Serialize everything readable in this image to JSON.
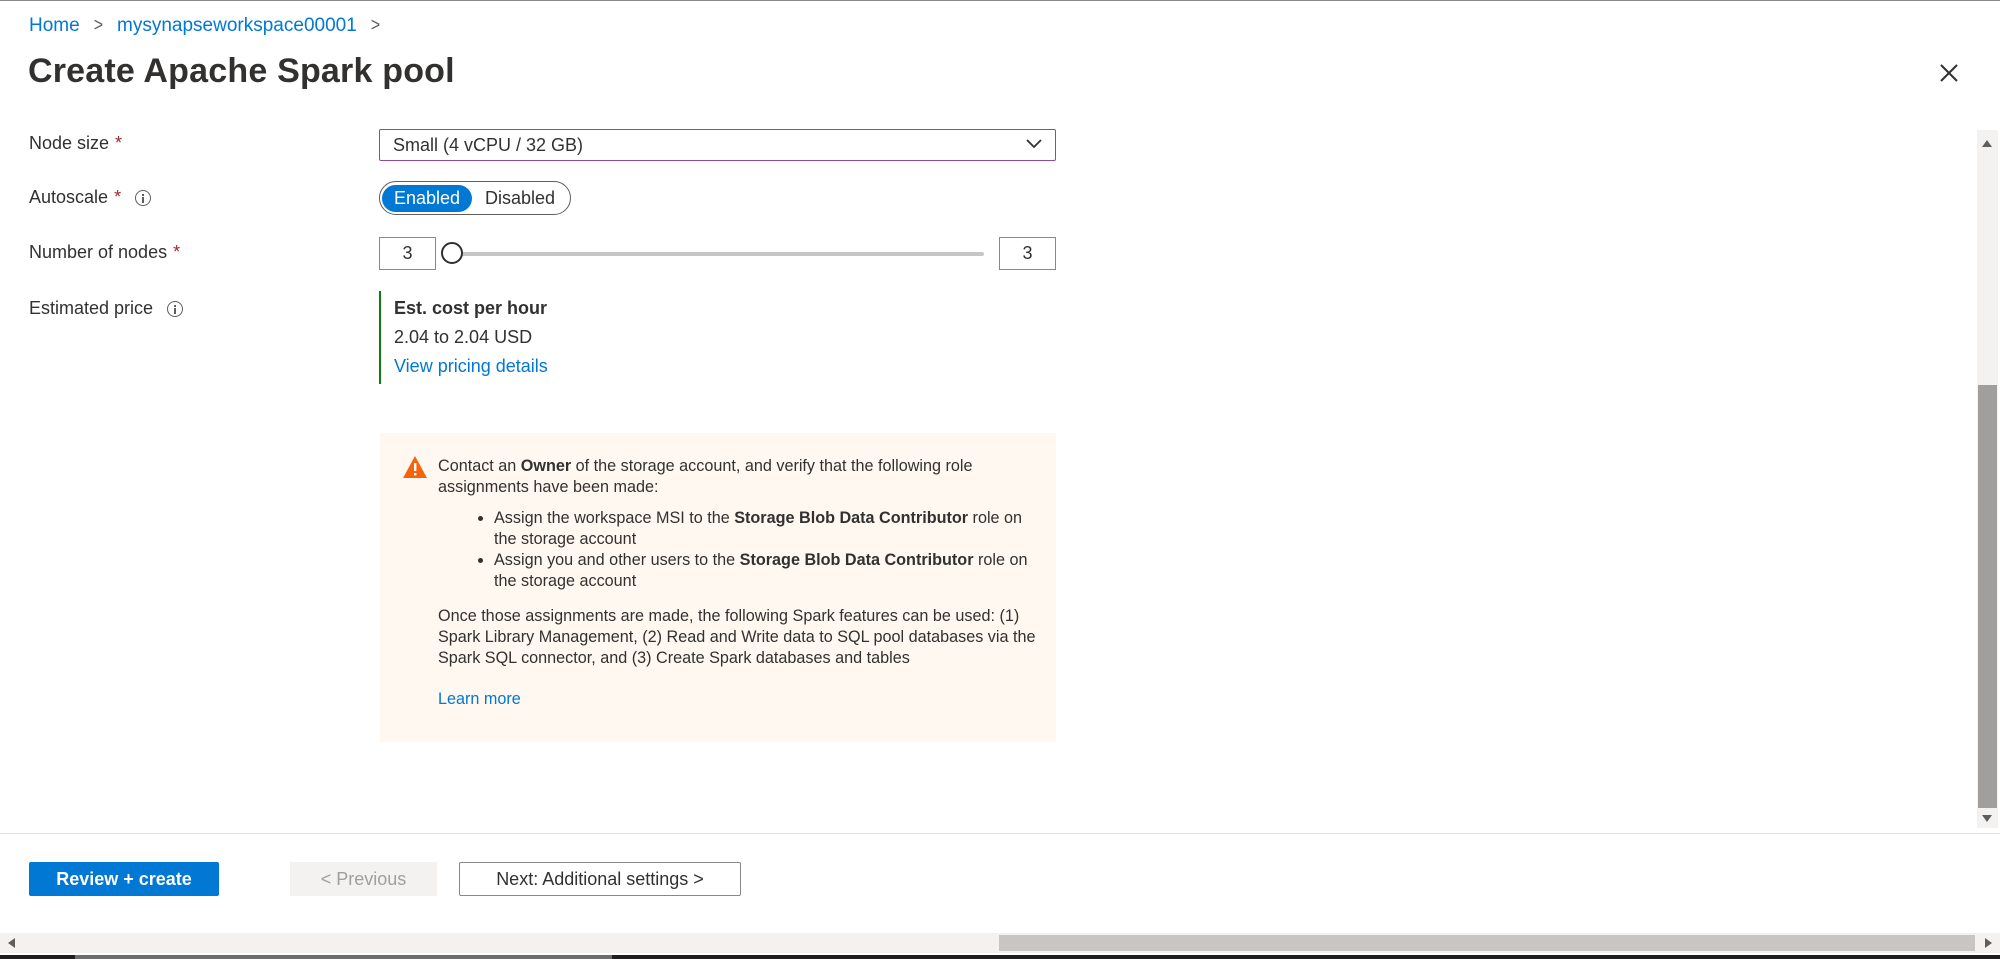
{
  "breadcrumb": {
    "items": [
      "Home",
      "mysynapseworkspace00001"
    ],
    "separator": ">"
  },
  "page_title": "Create Apache Spark pool",
  "form": {
    "node_size": {
      "label": "Node size",
      "required_mark": "*",
      "value": "Small (4 vCPU / 32 GB)"
    },
    "autoscale": {
      "label": "Autoscale",
      "required_mark": "*",
      "options": [
        "Enabled",
        "Disabled"
      ],
      "selected": "Enabled"
    },
    "number_of_nodes": {
      "label": "Number of nodes",
      "required_mark": "*",
      "min_value": "3",
      "max_value": "3"
    },
    "estimated_price": {
      "label": "Estimated price",
      "title": "Est. cost per hour",
      "value": "2.04 to 2.04 USD",
      "link": "View pricing details"
    }
  },
  "warning": {
    "intro_prefix": "Contact an ",
    "intro_bold": "Owner",
    "intro_suffix": " of the storage account, and verify that the following role assignments have been made:",
    "bullets": [
      {
        "prefix": "Assign the workspace MSI to the ",
        "bold": "Storage Blob Data Contributor",
        "suffix": " role on the storage account"
      },
      {
        "prefix": "Assign you and other users to the ",
        "bold": "Storage Blob Data Contributor",
        "suffix": " role on the storage account"
      }
    ],
    "paragraph": "Once those assignments are made, the following Spark features can be used: (1) Spark Library Management, (2) Read and Write data to SQL pool databases via the Spark SQL connector, and (3) Create Spark databases and tables",
    "learn_more": "Learn more"
  },
  "footer": {
    "review_create": "Review + create",
    "previous": "< Previous",
    "next": "Next: Additional settings >"
  },
  "colors": {
    "accent": "#0078d4",
    "required": "#a4262c",
    "price_border": "#107c10",
    "warning_bg": "#fff8f0",
    "warning_icon": "#f7630c"
  }
}
